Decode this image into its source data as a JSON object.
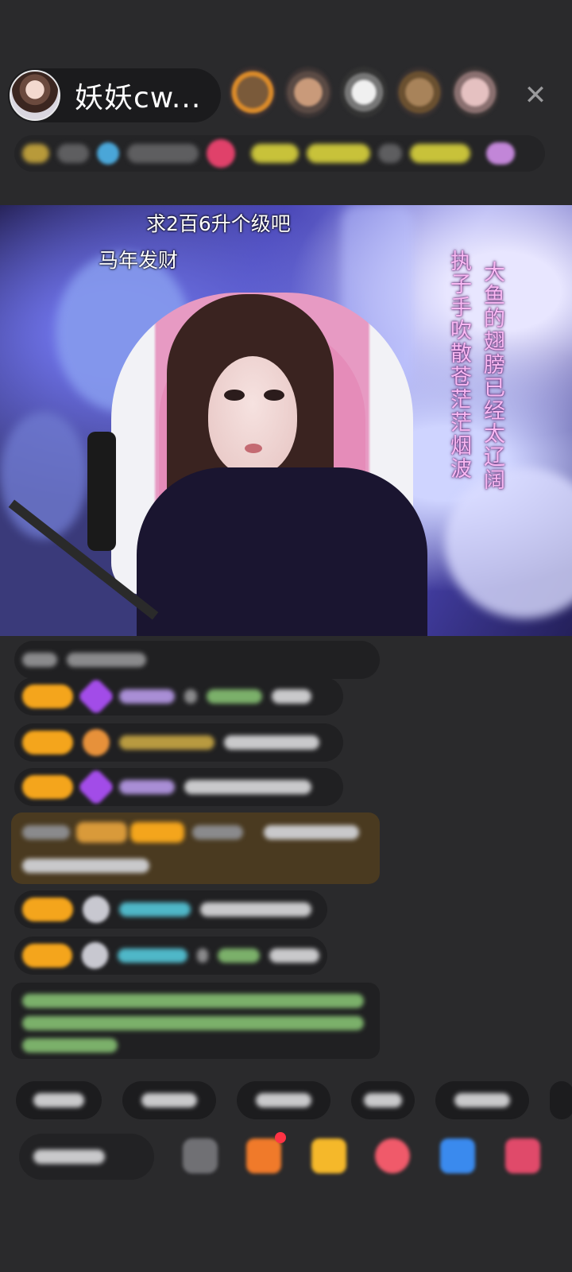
{
  "header": {
    "host_name": "妖妖cw...",
    "close_icon": "close-icon"
  },
  "video_overlay": {
    "comment_1": "求2百6升个级吧",
    "comment_2": "马年发财",
    "lyric_line_1": "大鱼的翅膀已经太辽阔",
    "lyric_line_2": "执子手吹散苍茫茫烟波"
  },
  "colors": {
    "background": "#2a2a2c",
    "badge": "#f4a51c",
    "lyrics": "#f8b8f2"
  }
}
